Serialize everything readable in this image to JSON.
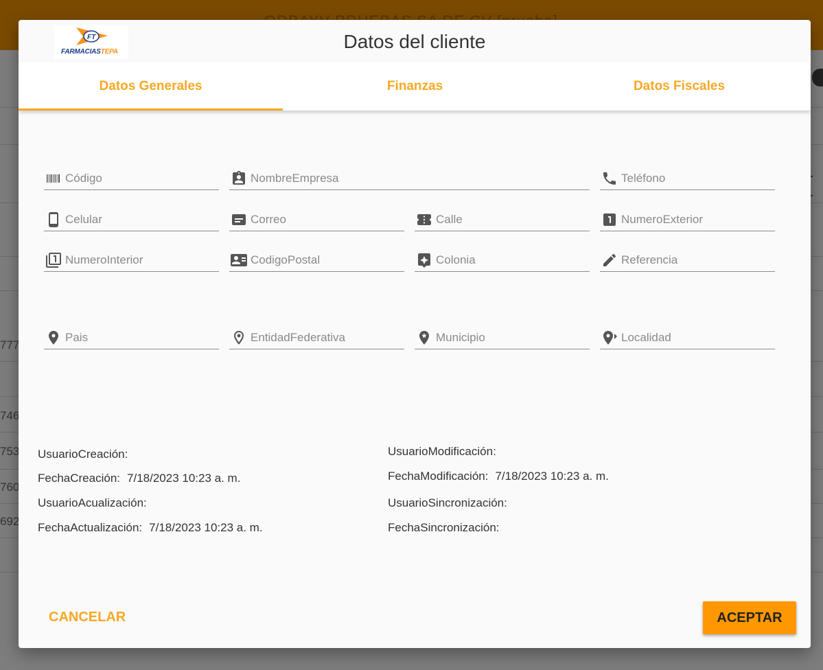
{
  "background": {
    "title": "ODBAYV PRUEBAS SA DE CV [prueba]",
    "left_numbers": [
      "777",
      "746",
      "753",
      "760",
      "692"
    ]
  },
  "dialog": {
    "title": "Datos del cliente",
    "logo": {
      "brand": "FARMACIAS",
      "brand_accent": "TEPA",
      "mark": "FT"
    },
    "tabs": [
      {
        "label": "Datos Generales",
        "active": true
      },
      {
        "label": "Finanzas",
        "active": false
      },
      {
        "label": "Datos Fiscales",
        "active": false
      }
    ],
    "fields": {
      "codigo": {
        "placeholder": "Código",
        "icon": "barcode-icon"
      },
      "nombre_empresa": {
        "placeholder": "NombreEmpresa",
        "icon": "contact-card-icon"
      },
      "telefono": {
        "placeholder": "Teléfono",
        "icon": "phone-icon"
      },
      "celular": {
        "placeholder": "Celular",
        "icon": "smartphone-icon"
      },
      "correo": {
        "placeholder": "Correo",
        "icon": "card-icon"
      },
      "calle": {
        "placeholder": "Calle",
        "icon": "ticket-icon"
      },
      "numero_exterior": {
        "placeholder": "NumeroExterior",
        "icon": "number-one-icon"
      },
      "numero_interior": {
        "placeholder": "NumeroInterior",
        "icon": "stacked-one-icon"
      },
      "codigo_postal": {
        "placeholder": "CodigoPostal",
        "icon": "id-card-icon"
      },
      "colonia": {
        "placeholder": "Colonia",
        "icon": "place-star-icon"
      },
      "referencia": {
        "placeholder": "Referencia",
        "icon": "pencil-icon"
      },
      "pais": {
        "placeholder": "Pais",
        "icon": "location-pin-icon"
      },
      "entidad_federativa": {
        "placeholder": "EntidadFederativa",
        "icon": "location-outline-icon"
      },
      "municipio": {
        "placeholder": "Municipio",
        "icon": "location-star-icon"
      },
      "localidad": {
        "placeholder": "Localidad",
        "icon": "location-arrow-icon"
      }
    },
    "audit": {
      "usuario_creacion": {
        "label": "UsuarioCreación:",
        "value": ""
      },
      "fecha_creacion": {
        "label": "FechaCreación:",
        "value": "7/18/2023 10:23 a. m."
      },
      "usuario_actualizacion": {
        "label": "UsuarioAcualización:",
        "value": ""
      },
      "fecha_actualizacion": {
        "label": "FechaActualización:",
        "value": "7/18/2023 10:23 a. m."
      },
      "usuario_modificacion": {
        "label": "UsuarioModificación:",
        "value": ""
      },
      "fecha_modificacion": {
        "label": "FechaModificación:",
        "value": "7/18/2023 10:23 a. m."
      },
      "usuario_sincronizacion": {
        "label": "UsuarioSincronización:",
        "value": ""
      },
      "fecha_sincronizacion": {
        "label": "FechaSincronización:",
        "value": ""
      }
    },
    "buttons": {
      "cancel": "CANCELAR",
      "accept": "ACEPTAR"
    },
    "colors": {
      "accent": "#f7a823",
      "accept_bg": "#ff9800",
      "brand_blue": "#1b3c8a"
    }
  }
}
